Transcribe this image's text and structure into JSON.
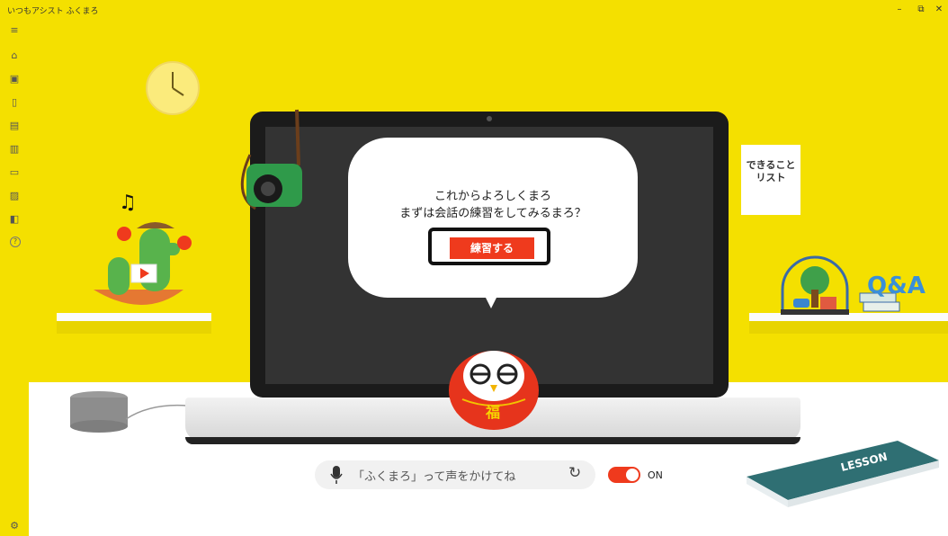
{
  "window": {
    "title": "いつもアシスト ふくまろ",
    "minimize": "–",
    "restore": "⧉",
    "close": "✕"
  },
  "sidebar": {
    "items": [
      {
        "icon": "menu-icon",
        "glyph": "≡"
      },
      {
        "icon": "home-icon",
        "glyph": "⌂"
      },
      {
        "icon": "photo-icon",
        "glyph": "▣"
      },
      {
        "icon": "remote-icon",
        "glyph": "▯"
      },
      {
        "icon": "clipboard-icon",
        "glyph": "▤"
      },
      {
        "icon": "document-icon",
        "glyph": "▥"
      },
      {
        "icon": "tv-icon",
        "glyph": "▭"
      },
      {
        "icon": "picture-icon",
        "glyph": "▨"
      },
      {
        "icon": "book-icon",
        "glyph": "◧"
      },
      {
        "icon": "help-icon",
        "glyph": "?"
      }
    ],
    "settings_glyph": "⚙"
  },
  "dialog": {
    "line1": "これからよろしくまろ",
    "line2": "まずは会話の練習をしてみるまろ？",
    "practice_button": "練習する"
  },
  "voice": {
    "hint": "「ふくまろ」って声をかけてね",
    "refresh_glyph": "↻",
    "toggle_state": "ON"
  },
  "decor": {
    "poster_text_line1": "できること",
    "poster_text_line2": "リスト",
    "book_title": "LESSON",
    "daruma_kanji": "福",
    "letters": "Q&A",
    "music_note": "♫"
  },
  "colors": {
    "background": "#f4e000",
    "accent": "#ef3a1d",
    "screen": "#333333"
  }
}
